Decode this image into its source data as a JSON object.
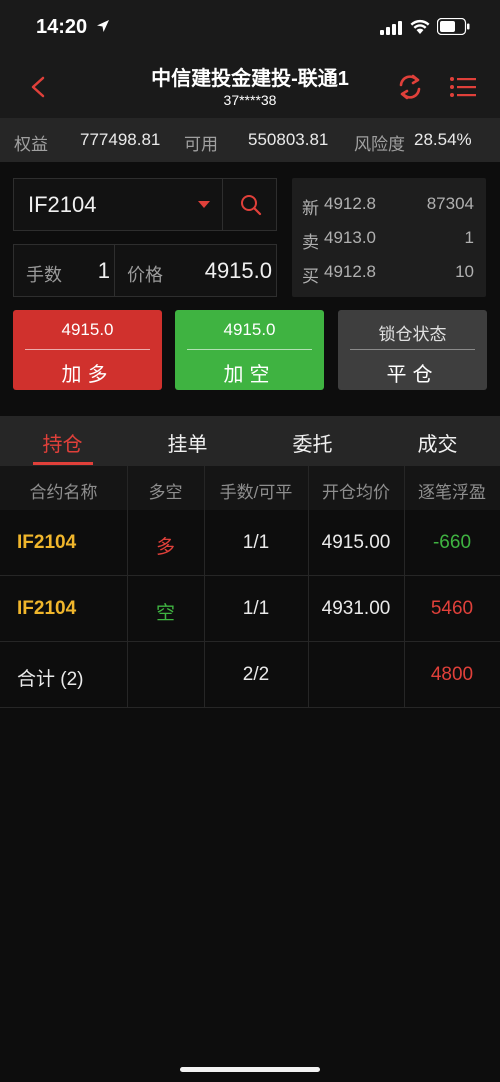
{
  "status_bar": {
    "time": "14:20"
  },
  "header": {
    "title": "中信建投金建投-联通1",
    "subtitle": "37****38"
  },
  "account": {
    "equity_label": "权益",
    "equity_value": "777498.81",
    "available_label": "可用",
    "available_value": "550803.81",
    "risk_label": "风险度",
    "risk_value": "28.54%"
  },
  "order": {
    "symbol": "IF2104",
    "qty_label": "手数",
    "qty_value": "1",
    "price_label": "价格",
    "price_value": "4915.0"
  },
  "quote": [
    {
      "label": "新",
      "price": "4912.8",
      "volume": "87304"
    },
    {
      "label": "卖",
      "price": "4913.0",
      "volume": "1"
    },
    {
      "label": "买",
      "price": "4912.8",
      "volume": "10"
    }
  ],
  "buttons": {
    "long": {
      "top": "4915.0",
      "bottom": "加多"
    },
    "short": {
      "top": "4915.0",
      "bottom": "加空"
    },
    "close": {
      "top": "锁仓状态",
      "bottom": "平仓"
    }
  },
  "tabs": [
    "持仓",
    "挂单",
    "委托",
    "成交"
  ],
  "table": {
    "headers": [
      "合约名称",
      "多空",
      "手数/可平",
      "开仓均价",
      "逐笔浮盈"
    ],
    "rows": [
      {
        "symbol": "IF2104",
        "side": "多",
        "qty": "1/1",
        "avg_price": "4915.00",
        "pnl": "-660"
      },
      {
        "symbol": "IF2104",
        "side": "空",
        "qty": "1/1",
        "avg_price": "4931.00",
        "pnl": "5460"
      }
    ],
    "total": {
      "label": "合计 (2)",
      "qty": "2/2",
      "pnl": "4800"
    }
  },
  "colors": {
    "red": "#d0312d",
    "green": "#3fb341",
    "accent": "#e0403a",
    "symbol_yellow": "#f0b62c"
  }
}
